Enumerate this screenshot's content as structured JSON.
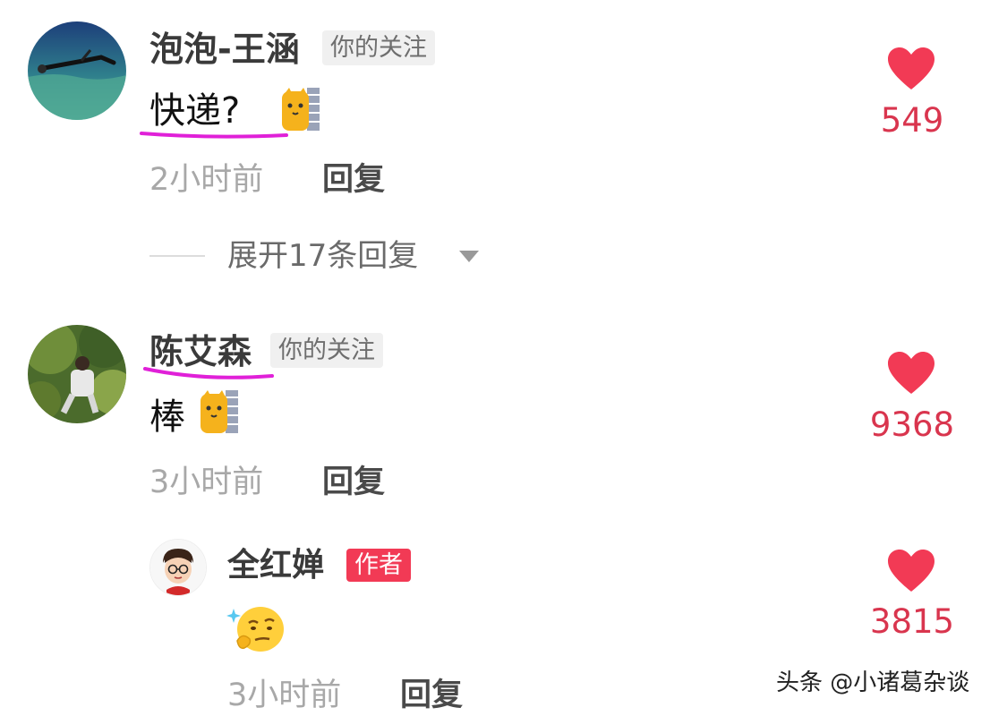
{
  "comments": [
    {
      "username": "泡泡-王涵",
      "follow_tag": "你的关注",
      "text": "快递?",
      "emoji": "cat-peek-emoji",
      "time": "2小时前",
      "reply_label": "回复",
      "likes": "549",
      "expand_label": "展开17条回复"
    },
    {
      "username": "陈艾森",
      "follow_tag": "你的关注",
      "text": "棒",
      "emoji": "cat-peek-emoji",
      "time": "3小时前",
      "reply_label": "回复",
      "likes": "9368",
      "reply": {
        "username": "全红婵",
        "author_tag": "作者",
        "emoji": "thinking-emoji",
        "time": "3小时前",
        "reply_label": "回复",
        "likes": "3815"
      }
    }
  ],
  "watermark": "头条 @小诸葛杂谈",
  "colors": {
    "heart": "#f23a55",
    "like_count": "#d9354e",
    "highlight_underline": "#e020d8",
    "author_tag": "#f23a55"
  }
}
